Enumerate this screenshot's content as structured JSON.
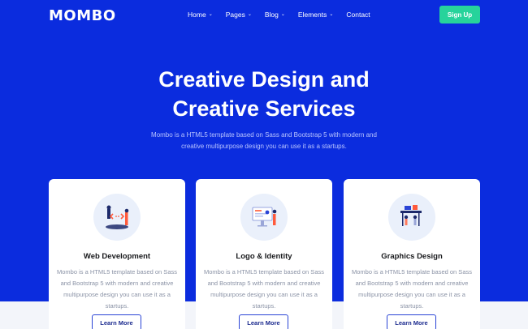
{
  "header": {
    "logo": "MOMBO",
    "nav": [
      {
        "label": "Home",
        "has_dropdown": true
      },
      {
        "label": "Pages",
        "has_dropdown": true
      },
      {
        "label": "Blog",
        "has_dropdown": true
      },
      {
        "label": "Elements",
        "has_dropdown": true
      },
      {
        "label": "Contact",
        "has_dropdown": false
      }
    ],
    "signup_label": "Sign Up"
  },
  "hero": {
    "title_line1": "Creative Design and",
    "title_line2": "Creative Services",
    "subtitle_line1": "Mombo is a HTML5 template based on Sass and Bootstrap 5 with modern and",
    "subtitle_line2": "creative multipurpose design you can use it as a startups."
  },
  "cards": [
    {
      "title": "Web Development",
      "text_lines": [
        "Mombo is a HTML5 template based on Sass",
        "and Bootstrap 5 with modern and creative",
        "multipurpose design you can use it as a",
        "startups."
      ],
      "button": "Learn More",
      "icon": "web-development-illustration-icon"
    },
    {
      "title": "Logo & Identity",
      "text_lines": [
        "Mombo is a HTML5 template based on Sass",
        "and Bootstrap 5 with modern and creative",
        "multipurpose design you can use it as a",
        "startups."
      ],
      "button": "Learn More",
      "icon": "logo-identity-illustration-icon"
    },
    {
      "title": "Graphics Design",
      "text_lines": [
        "Mombo is a HTML5 template based on Sass",
        "and Bootstrap 5 with modern and creative",
        "multipurpose design you can use it as a",
        "startups."
      ],
      "button": "Learn More",
      "icon": "graphics-design-illustration-icon"
    }
  ],
  "colors": {
    "hero_bg": "#0b2cde",
    "signup_bg": "#27d39b",
    "page_bg": "#f3f5fa",
    "button_border": "#2a44d6"
  }
}
